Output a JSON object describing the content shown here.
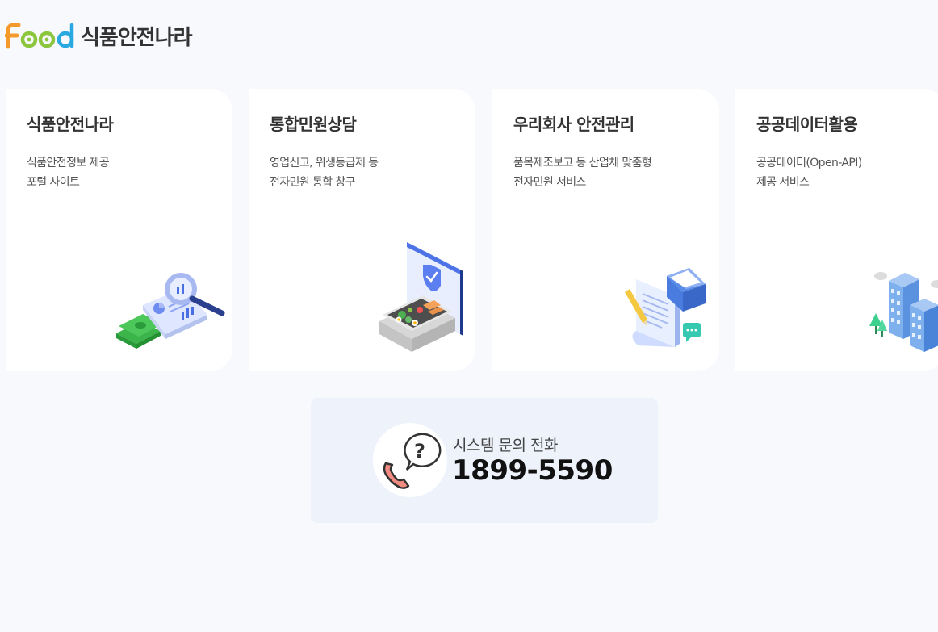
{
  "logo": {
    "brand_en": "Food",
    "brand_ko": "식품안전나라"
  },
  "cards": [
    {
      "title": "식품안전나라",
      "desc_lines": [
        "식품안전정보 제공",
        "포털 사이트"
      ],
      "icon": "magnifier-document-money-icon"
    },
    {
      "title": "통합민원상담",
      "desc_lines": [
        "영업신고, 위생등급제 등",
        "전자민원 통합 창구"
      ],
      "icon": "checked-food-tray-icon"
    },
    {
      "title": "우리회사 안전관리",
      "desc_lines": [
        "품목제조보고 등 산업체 맞춤형",
        "전자민원 서비스"
      ],
      "icon": "document-envelope-icon"
    },
    {
      "title": "공공데이터활용",
      "desc_lines": [
        "공공데이터(Open-API)",
        "제공 서비스"
      ],
      "icon": "city-buildings-icon"
    }
  ],
  "contact": {
    "label": "시스템 문의 전화",
    "phone": "1899-5590",
    "icon": "phone-question-icon"
  },
  "colors": {
    "logo_orange": "#f39a2b",
    "logo_green": "#8cc63f",
    "logo_blue": "#29a9e0",
    "page_bg": "#f8f9fd",
    "contact_bg": "#edf2fb"
  }
}
